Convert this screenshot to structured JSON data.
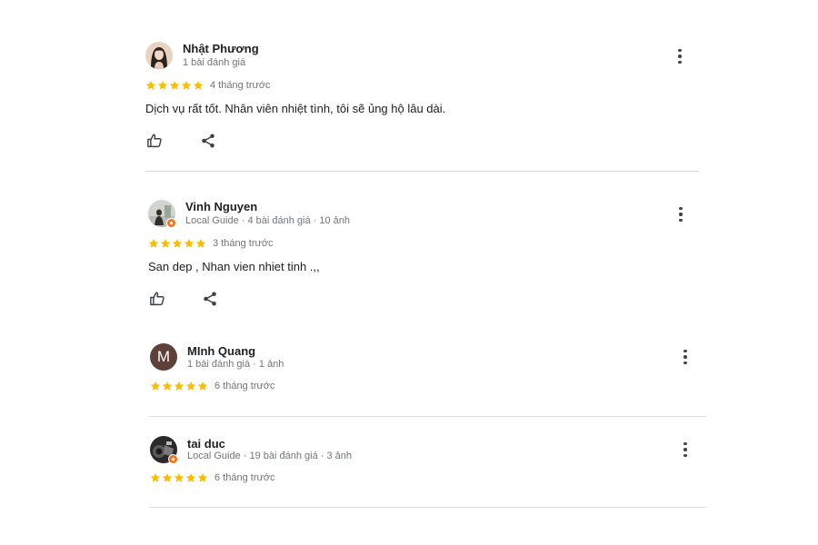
{
  "reviews": [
    {
      "name": "Nhật Phương",
      "meta": "1 bài đánh giá",
      "rating": 5,
      "time": "4 tháng trước",
      "text": "Dịch vụ rất tốt. Nhân viên nhiệt tình, tôi sẽ ủng hộ lâu dài.",
      "avatar": "photo",
      "local_guide": false
    },
    {
      "name": "Vinh Nguyen",
      "meta": "Local Guide · 4 bài đánh giá · 10 ảnh",
      "rating": 5,
      "time": "3 tháng trước",
      "text": "San dep , Nhan vien nhiet tinh .,,",
      "avatar": "photo",
      "local_guide": true
    },
    {
      "name": "MInh Quang",
      "meta": "1 bài đánh giá · 1 ảnh",
      "rating": 5,
      "time": "6 tháng trước",
      "avatar": "letter",
      "avatar_letter": "M",
      "avatar_color": "#5d4037",
      "local_guide": false
    },
    {
      "name": "tai duc",
      "meta": "Local Guide · 19 bài đánh giá · 3 ảnh",
      "rating": 5,
      "time": "6 tháng trước",
      "avatar": "photo",
      "local_guide": true
    }
  ],
  "icons": {
    "more": "more-vert-icon",
    "like": "thumb-up-icon",
    "share": "share-icon",
    "star": "star-icon",
    "badge": "local-guide-badge-icon"
  },
  "colors": {
    "star": "#fbbc04",
    "badge": "#f96d12",
    "divider": "#dadce0",
    "muted": "#70757a"
  }
}
